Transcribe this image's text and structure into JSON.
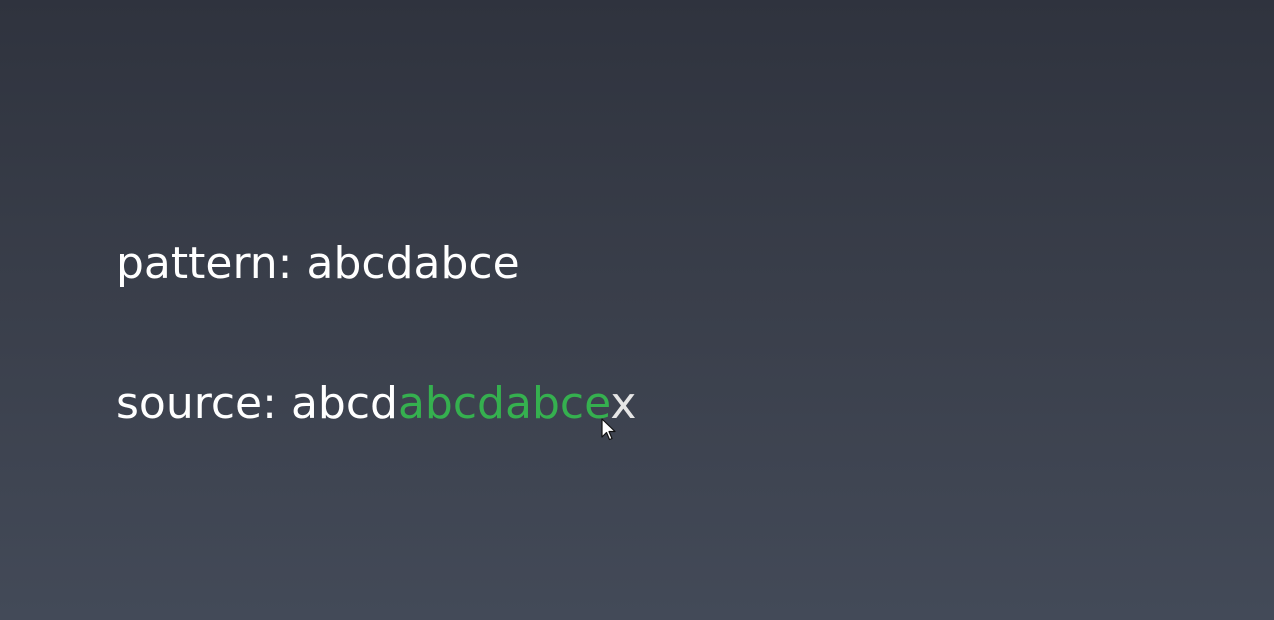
{
  "pattern_line": {
    "label": "pattern:",
    "value": "abcdabce"
  },
  "source_line": {
    "label": "source:",
    "prefix": "abcd",
    "match": "abcdabce",
    "suffix": "x"
  },
  "colors": {
    "background_top": "#2f333e",
    "background_bottom": "#434a58",
    "text": "#ffffff",
    "match_highlight": "#35b04f"
  },
  "icons": {
    "cursor": "mouse-pointer-icon"
  }
}
